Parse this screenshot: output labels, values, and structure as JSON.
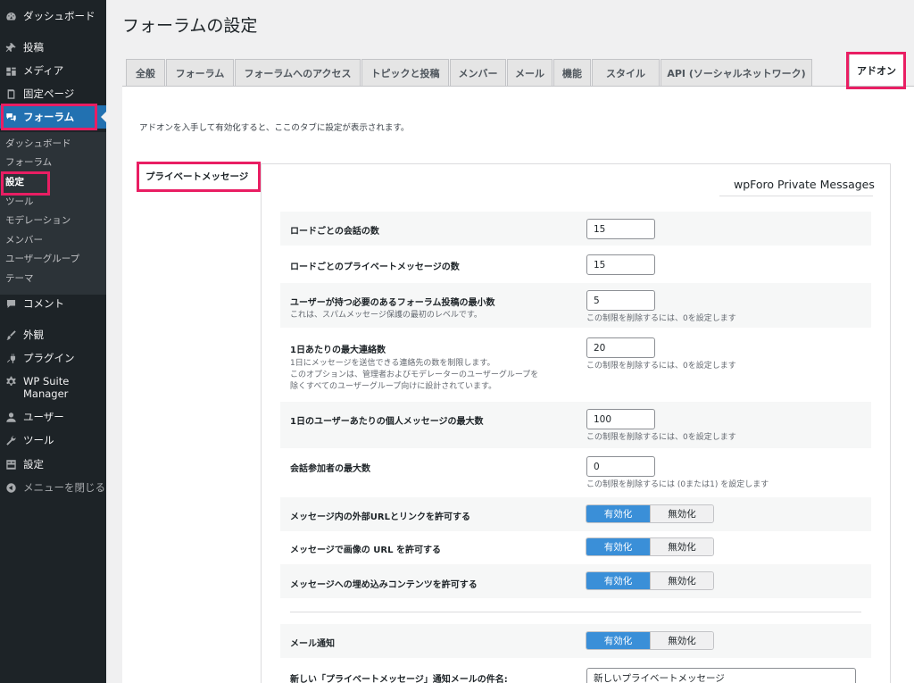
{
  "sidebar": {
    "items": [
      {
        "label": "ダッシュボード",
        "icon": "dashboard-icon"
      },
      {
        "label": "投稿",
        "icon": "pin-icon"
      },
      {
        "label": "メディア",
        "icon": "media-icon"
      },
      {
        "label": "固定ページ",
        "icon": "page-icon"
      },
      {
        "label": "フォーラム",
        "icon": "forum-icon"
      },
      {
        "label": "コメント",
        "icon": "comment-icon"
      },
      {
        "label": "外観",
        "icon": "brush-icon"
      },
      {
        "label": "プラグイン",
        "icon": "plugin-icon"
      },
      {
        "label": "WP Suite Manager",
        "icon": "gear-icon"
      },
      {
        "label": "ユーザー",
        "icon": "user-icon"
      },
      {
        "label": "ツール",
        "icon": "wrench-icon"
      },
      {
        "label": "設定",
        "icon": "settings-icon"
      },
      {
        "label": "メニューを閉じる",
        "icon": "collapse-icon"
      }
    ],
    "submenu": [
      "ダッシュボード",
      "フォーラム",
      "設定",
      "ツール",
      "モデレーション",
      "メンバー",
      "ユーザーグループ",
      "テーマ"
    ]
  },
  "page": {
    "title": "フォーラムの設定",
    "intro": "アドオンを入手して有効化すると、ここのタブに設定が表示されます。"
  },
  "tabs": [
    "全般",
    "フォーラム",
    "フォーラムへのアクセス",
    "トピックと投稿",
    "メンバー",
    "メール",
    "機能",
    "スタイル",
    "API (ソーシャルネットワーク)",
    "アドオン"
  ],
  "section": {
    "label": "プライベートメッセージ",
    "box_title": "wpForo Private Messages"
  },
  "settings": [
    {
      "label": "ロードごとの会話の数",
      "value": "15"
    },
    {
      "label": "ロードごとのプライベートメッセージの数",
      "value": "15"
    },
    {
      "label": "ユーザーが持つ必要のあるフォーラム投稿の最小数",
      "desc": "これは、スパムメッセージ保護の最初のレベルです。",
      "value": "5",
      "hint": "この制限を削除するには、0を設定します"
    },
    {
      "label": "1日あたりの最大連絡数",
      "desc1": "1日にメッセージを送信できる連絡先の数を制限します。",
      "desc2": "このオプションは、管理者およびモデレーターのユーザーグループを",
      "desc3": "除くすべてのユーザーグループ向けに設計されています。",
      "value": "20",
      "hint": "この制限を削除するには、0を設定します"
    },
    {
      "label": "1日のユーザーあたりの個人メッセージの最大数",
      "value": "100",
      "hint": "この制限を削除するには、0を設定します"
    },
    {
      "label": "会話参加者の最大数",
      "value": "0",
      "hint": "この制限を削除するには (0または1) を設定します"
    },
    {
      "label": "メッセージ内の外部URLとリンクを許可する",
      "on": "有効化",
      "off": "無効化"
    },
    {
      "label": "メッセージで画像の URL を許可する",
      "on": "有効化",
      "off": "無効化"
    },
    {
      "label": "メッセージへの埋め込みコンテンツを許可する",
      "on": "有効化",
      "off": "無効化"
    },
    {
      "label": "メール通知",
      "on": "有効化",
      "off": "無効化"
    },
    {
      "label": "新しい「プライベートメッセージ」通知メールの件名:",
      "value": "新しいプライベートメッセージ"
    }
  ],
  "colors": {
    "accent": "#2271b1",
    "toggle_on": "#3a8fd8",
    "highlight": "#e91e63"
  }
}
